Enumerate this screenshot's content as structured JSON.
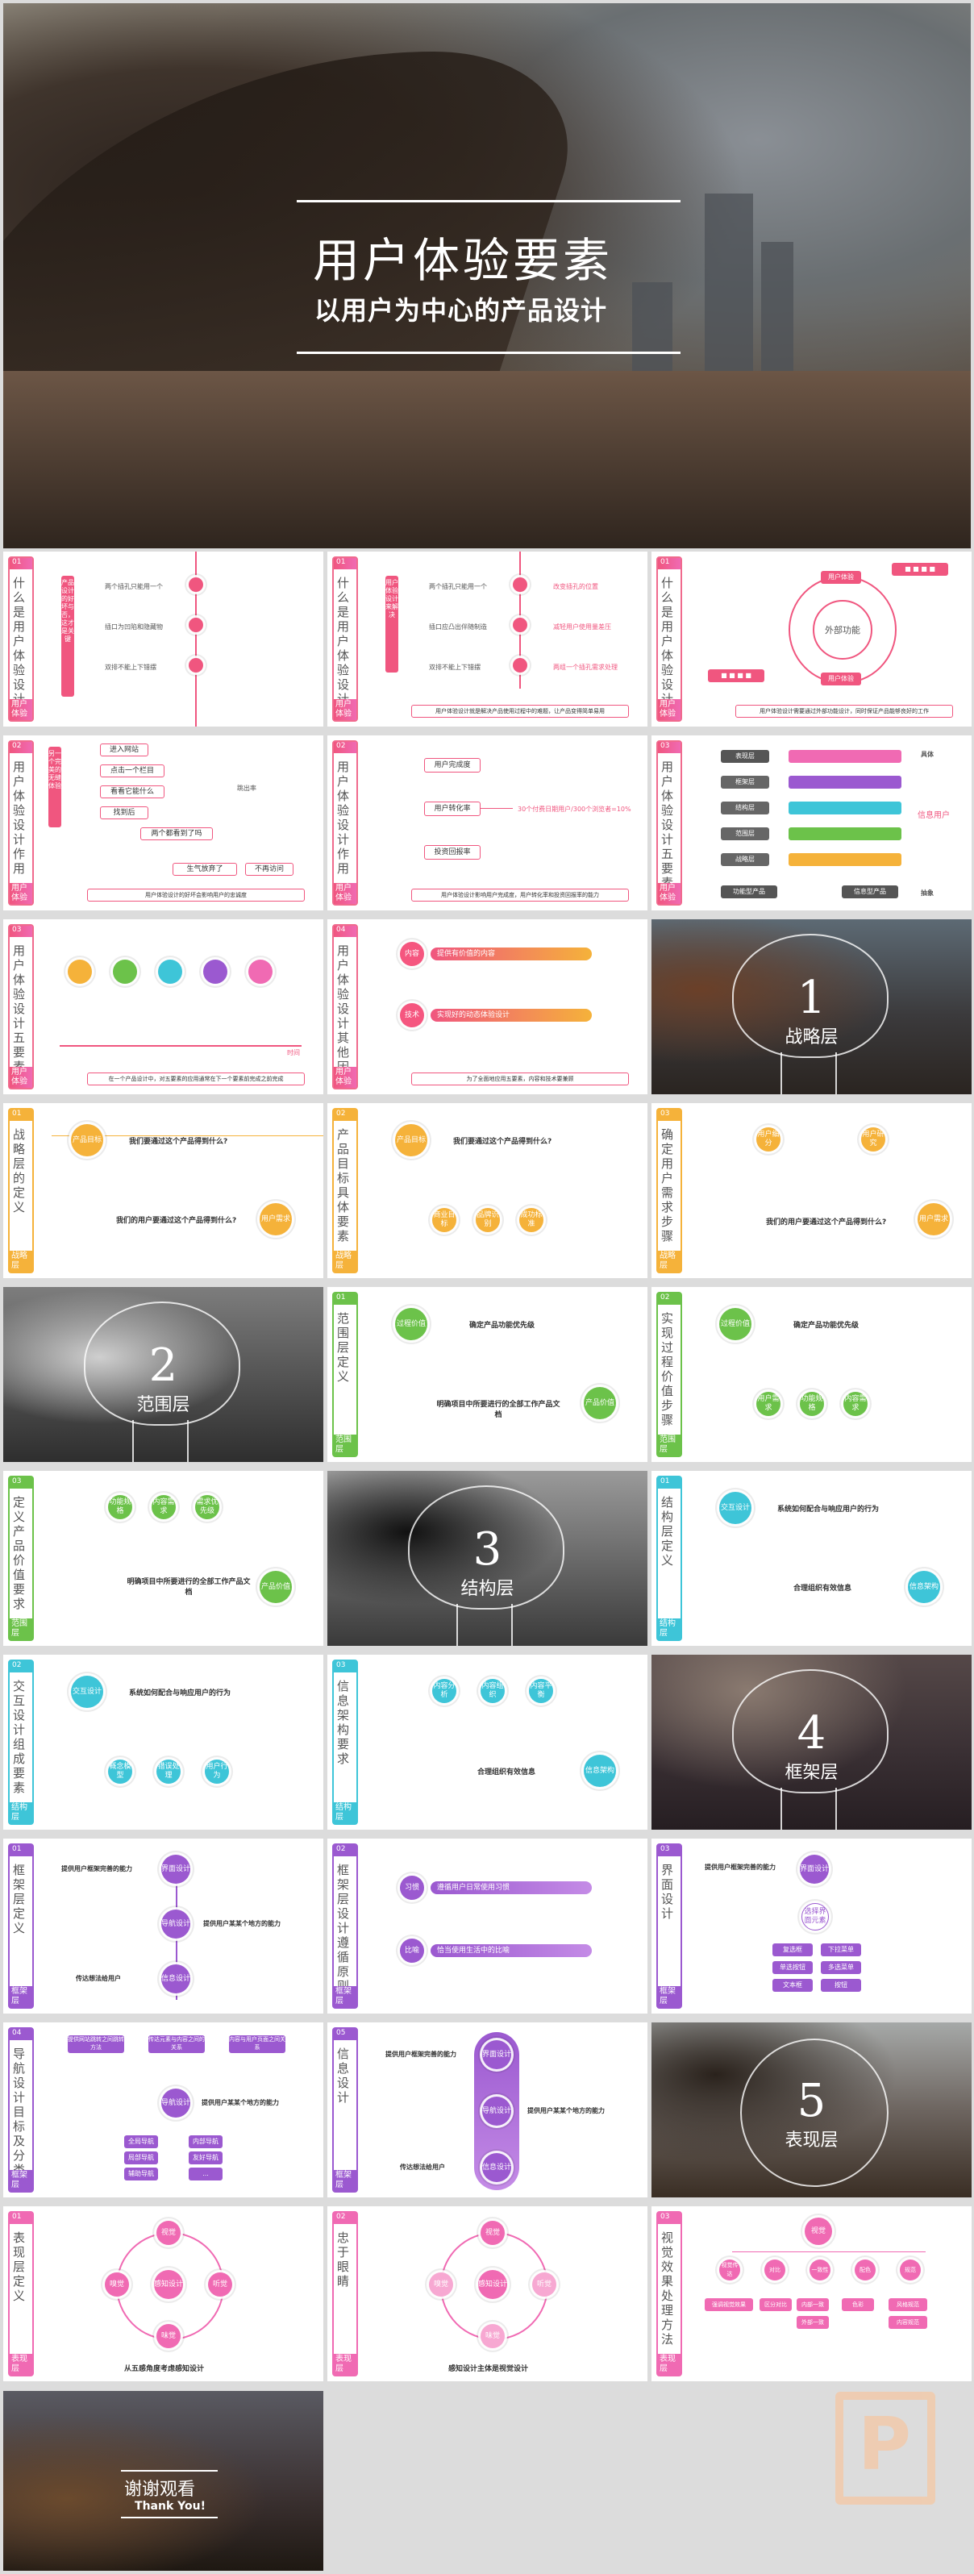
{
  "hero": {
    "title": "用户体验要素",
    "subtitle": "以用户为中心的产品设计"
  },
  "s1": {
    "num": "01",
    "vt": "什么是用户体验设计",
    "ft": "用户体验",
    "vlabel": "产品设计的好坏与否，这才是关键",
    "items": [
      "两个插孔只能用一个",
      "插口为凹陷和隐藏物",
      "双排不能上下错摆"
    ],
    "foot": ""
  },
  "s2": {
    "num": "01",
    "vt": "什么是用户体验设计",
    "ft": "用户体验",
    "vlabel": "用户体验设计来解决",
    "items": [
      "两个插孔只能用一个",
      "插口应凸出伴随制造",
      "双排不能上下错摆"
    ],
    "right": [
      "改变插孔的位置",
      "减轻用户使用量差压",
      "两组一个插孔需求处理"
    ],
    "foot": "用户体验设计就是解决产品使用过程中的难题，让产品变得简单易用"
  },
  "s3": {
    "num": "01",
    "vt": "什么是用户体验设计",
    "ft": "用户体验",
    "center": "外部功能",
    "labels": [
      "用户体验",
      "外部功能",
      "用户体验"
    ],
    "foot": "用户体验设计需要通过外部功能设计，同时保证产品能够良好的工作"
  },
  "s4": {
    "num": "02",
    "vt": "用户体验设计作用",
    "ft": "用户体验",
    "vlabel": "另一个完美的无缝体验",
    "steps": [
      "进入网站",
      "点击一个栏目",
      "看看它能什么",
      "找到后",
      "两个都看到了吗",
      "生气放弃了"
    ],
    "right": [
      "不再访问"
    ],
    "side": "跳出率",
    "foot": "用户体验设计的好坏会影响用户的忠诚度"
  },
  "s5": {
    "num": "02",
    "vt": "用户体验设计作用",
    "ft": "用户体验",
    "steps": [
      "用户完成度",
      "用户转化率",
      "投资回报率"
    ],
    "formula": "30个付费日期用户/300个浏览者=10%",
    "foot": "用户体验设计影响用户完成度，用户转化率和投资回报率的能力"
  },
  "s6": {
    "num": "03",
    "vt": "用户体验设计五要素",
    "ft": "用户体验",
    "layers": [
      "表现层",
      "框架层",
      "结构层",
      "范围层",
      "战略层"
    ],
    "right": "信息用户",
    "foot": [
      "功能型产品",
      "信息型产品"
    ],
    "top": "具体",
    "bot": "抽象"
  },
  "s7": {
    "num": "03",
    "vt": "用户体验设计五要素",
    "ft": "用户体验",
    "axis": "时间",
    "foot": "在一个产品设计中，对五要素的应用通常在下一个要素前完成之前完成"
  },
  "s8": {
    "num": "04",
    "vt": "用户体验设计其他因素",
    "ft": "用户体验",
    "rows": [
      {
        "tag": "内容",
        "text": "提供有价值的内容"
      },
      {
        "tag": "技术",
        "text": "实现好的动态体验设计"
      }
    ],
    "foot": "为了全面地应用五要素，内容和技术要兼顾"
  },
  "p1": {
    "n": "1",
    "l": "战略层"
  },
  "s9": {
    "num": "01",
    "vt": "战略层的定义",
    "ft": "战略层",
    "a": "产品目标",
    "b": "用户需求",
    "q1": "我们要通过这个产品得到什么?",
    "q2": "我们的用户要通过这个产品得到什么?"
  },
  "s10": {
    "num": "02",
    "vt": "产品目标具体要素",
    "ft": "战略层",
    "a": "产品目标",
    "q1": "我们要通过这个产品得到什么?",
    "subs": [
      "商业目标",
      "品牌识别",
      "成功标准"
    ]
  },
  "s11": {
    "num": "03",
    "vt": "确定用户需求步骤",
    "ft": "战略层",
    "a": "用户需求",
    "q1": "我们的用户要通过这个产品得到什么?",
    "subs": [
      "用户细分",
      "用户研究"
    ]
  },
  "p2": {
    "n": "2",
    "l": "范围层"
  },
  "s12": {
    "num": "01",
    "vt": "范围层定义",
    "ft": "范围层",
    "a": "过程价值",
    "b": "产品价值",
    "q1": "确定产品功能优先级",
    "q2": "明确项目中所要进行的全部工作产品文档"
  },
  "s13": {
    "num": "02",
    "vt": "实现过程价值步骤",
    "ft": "范围层",
    "a": "过程价值",
    "q1": "确定产品功能优先级",
    "subs": [
      "用户需求",
      "功能规格",
      "内容需求"
    ]
  },
  "s14": {
    "num": "03",
    "vt": "定义产品价值要求",
    "ft": "范围层",
    "b": "产品价值",
    "subs": [
      "功能规格",
      "内容需求",
      "需求优先级"
    ],
    "q2": "明确项目中所要进行的全部工作产品文档"
  },
  "p3": {
    "n": "3",
    "l": "结构层"
  },
  "s15": {
    "num": "01",
    "vt": "结构层定义",
    "ft": "结构层",
    "a": "交互设计",
    "b": "信息架构",
    "q1": "系统如何配合与响应用户的行为",
    "q2": "合理组织有效信息"
  },
  "s16": {
    "num": "02",
    "vt": "交互设计组成要素",
    "ft": "结构层",
    "a": "交互设计",
    "q1": "系统如何配合与响应用户的行为",
    "subs": [
      "概念模型",
      "错误处理",
      "用户行为"
    ]
  },
  "s17": {
    "num": "03",
    "vt": "信息架构要求",
    "ft": "结构层",
    "b": "信息架构",
    "subs": [
      "内容分析",
      "内容组织",
      "内容平衡"
    ],
    "q2": "合理组织有效信息"
  },
  "p4": {
    "n": "4",
    "l": "框架层"
  },
  "s18": {
    "num": "01",
    "vt": "框架层定义",
    "ft": "框架层",
    "nodes": [
      "界面设计",
      "导航设计",
      "信息设计"
    ],
    "t1": "提供用户框架完善的能力",
    "t2": "提供用户某某个地方的能力",
    "t3": "传达想法给用户"
  },
  "s19": {
    "num": "02",
    "vt": "框架层设计遵循原则",
    "ft": "框架层",
    "rows": [
      {
        "tag": "习惯",
        "text": "遵循用户日常使用习惯"
      },
      {
        "tag": "比喻",
        "text": "恰当使用生活中的比喻"
      }
    ]
  },
  "s20": {
    "num": "03",
    "vt": "界面设计",
    "ft": "框架层",
    "node": "界面设计",
    "t1": "提供用户框架完善的能力",
    "mid": "选择界面元素",
    "items": [
      "复选框",
      "下拉菜单",
      "单选按钮",
      "多选菜单",
      "文本框",
      "按钮"
    ]
  },
  "s21": {
    "num": "04",
    "vt": "导航设计目标及分类",
    "ft": "框架层",
    "node": "导航设计",
    "top": [
      "提供网站跳转之间跳转方法",
      "传达元素与内容之间的关系",
      "内容与用户页面之间关系"
    ],
    "t2": "提供用户某某个地方的能力",
    "left": [
      "全局导航",
      "局部导航",
      "辅助导航"
    ],
    "right": [
      "内部导航",
      "友好导航",
      "..."
    ]
  },
  "s22": {
    "num": "05",
    "vt": "信息设计",
    "ft": "框架层",
    "nodes": [
      "界面设计",
      "导航设计",
      "信息设计"
    ],
    "t1": "提供用户框架完善的能力",
    "t2": "提供用户某某个地方的能力",
    "t3": "传达想法给用户"
  },
  "p5": {
    "n": "5",
    "l": "表现层"
  },
  "s23": {
    "num": "01",
    "vt": "表现层定义",
    "ft": "表现层",
    "center": "感知设计",
    "nodes": [
      "视觉",
      "嗅觉",
      "听觉",
      "味觉"
    ],
    "foot": "从五感角度考虑感知设计"
  },
  "s24": {
    "num": "02",
    "vt": "忠于眼睛",
    "ft": "表现层",
    "center": "感知设计",
    "nodes": [
      "视觉",
      "嗅觉",
      "听觉",
      "味觉"
    ],
    "foot": "感知设计主体是视觉设计"
  },
  "s25": {
    "num": "03",
    "vt": "视觉效果处理方法",
    "ft": "表现层",
    "root": "视觉",
    "branches": [
      "视觉传达",
      "对比",
      "一致性",
      "配色",
      "规范"
    ],
    "leaves": [
      "强调视觉效果",
      "区分对比",
      "内部一致",
      "外部一致",
      "色彩",
      "风格规范",
      "内容规范"
    ]
  },
  "thanks": {
    "t1": "谢谢观看",
    "t2": "Thank You!"
  },
  "colors": {
    "red": "#f0567f",
    "orange": "#f5b23a",
    "green": "#6cc24a",
    "cyan": "#3ec5d8",
    "purple": "#9b59d0",
    "pink": "#f06ab3"
  }
}
